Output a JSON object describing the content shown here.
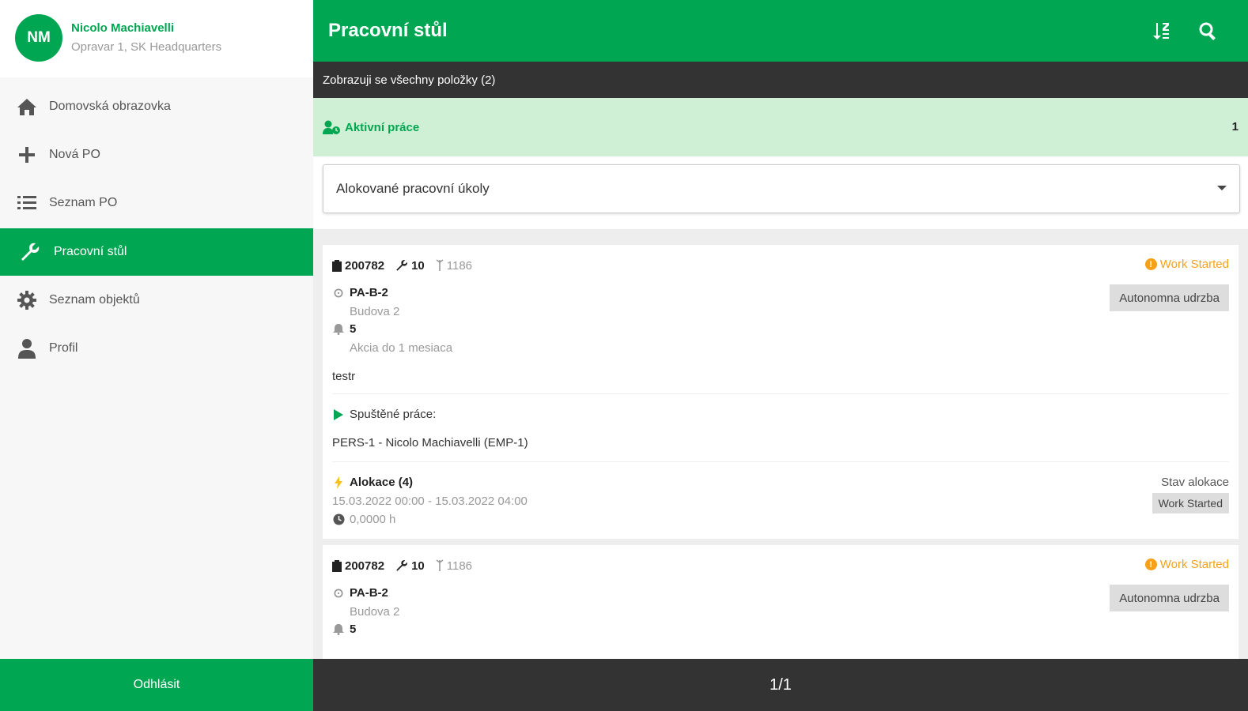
{
  "profile": {
    "initials": "NM",
    "name": "Nicolo Machiavelli",
    "subtitle": "Opravar 1, SK Headquarters"
  },
  "nav": {
    "items": [
      {
        "label": "Domovská obrazovka",
        "icon": "home-icon"
      },
      {
        "label": "Nová PO",
        "icon": "plus-icon"
      },
      {
        "label": "Seznam PO",
        "icon": "list-icon"
      },
      {
        "label": "Pracovní stůl",
        "icon": "wrench-icon",
        "active": true
      },
      {
        "label": "Seznam objektů",
        "icon": "gear-icon"
      },
      {
        "label": "Profil",
        "icon": "person-icon"
      }
    ],
    "logout_label": "Odhlásit"
  },
  "header": {
    "title": "Pracovní stůl"
  },
  "info_bar": "Zobrazuji se všechny položky (2)",
  "active_section": {
    "label": "Aktivní práce",
    "count": "1"
  },
  "filter": {
    "selected": "Alokované pracovní úkoly"
  },
  "cards": [
    {
      "order": "200782",
      "operation": "10",
      "ref": "1186",
      "status": "Work Started",
      "category": "Autonomna udrzba",
      "object_code": "PA-B-2",
      "object_location": "Budova 2",
      "priority": "5",
      "priority_desc": "Akcia do 1 mesiaca",
      "description": "testr",
      "started_label": "Spuštěné práce:",
      "worker": "PERS-1 - Nicolo Machiavelli (EMP-1)",
      "allocation_label": "Alokace (4)",
      "allocation_range": "15.03.2022 00:00 - 15.03.2022 04:00",
      "allocation_hours": "0,0000 h",
      "allocation_state_label": "Stav alokace",
      "allocation_state": "Work Started"
    },
    {
      "order": "200782",
      "operation": "10",
      "ref": "1186",
      "status": "Work Started",
      "category": "Autonomna udrzba",
      "object_code": "PA-B-2",
      "object_location": "Budova 2",
      "priority": "5"
    }
  ],
  "pagination": "1/1",
  "colors": {
    "brand_green": "#00a651",
    "light_green": "#cff0d4",
    "dark_bar": "#333333",
    "status_orange": "#f7a11a"
  }
}
